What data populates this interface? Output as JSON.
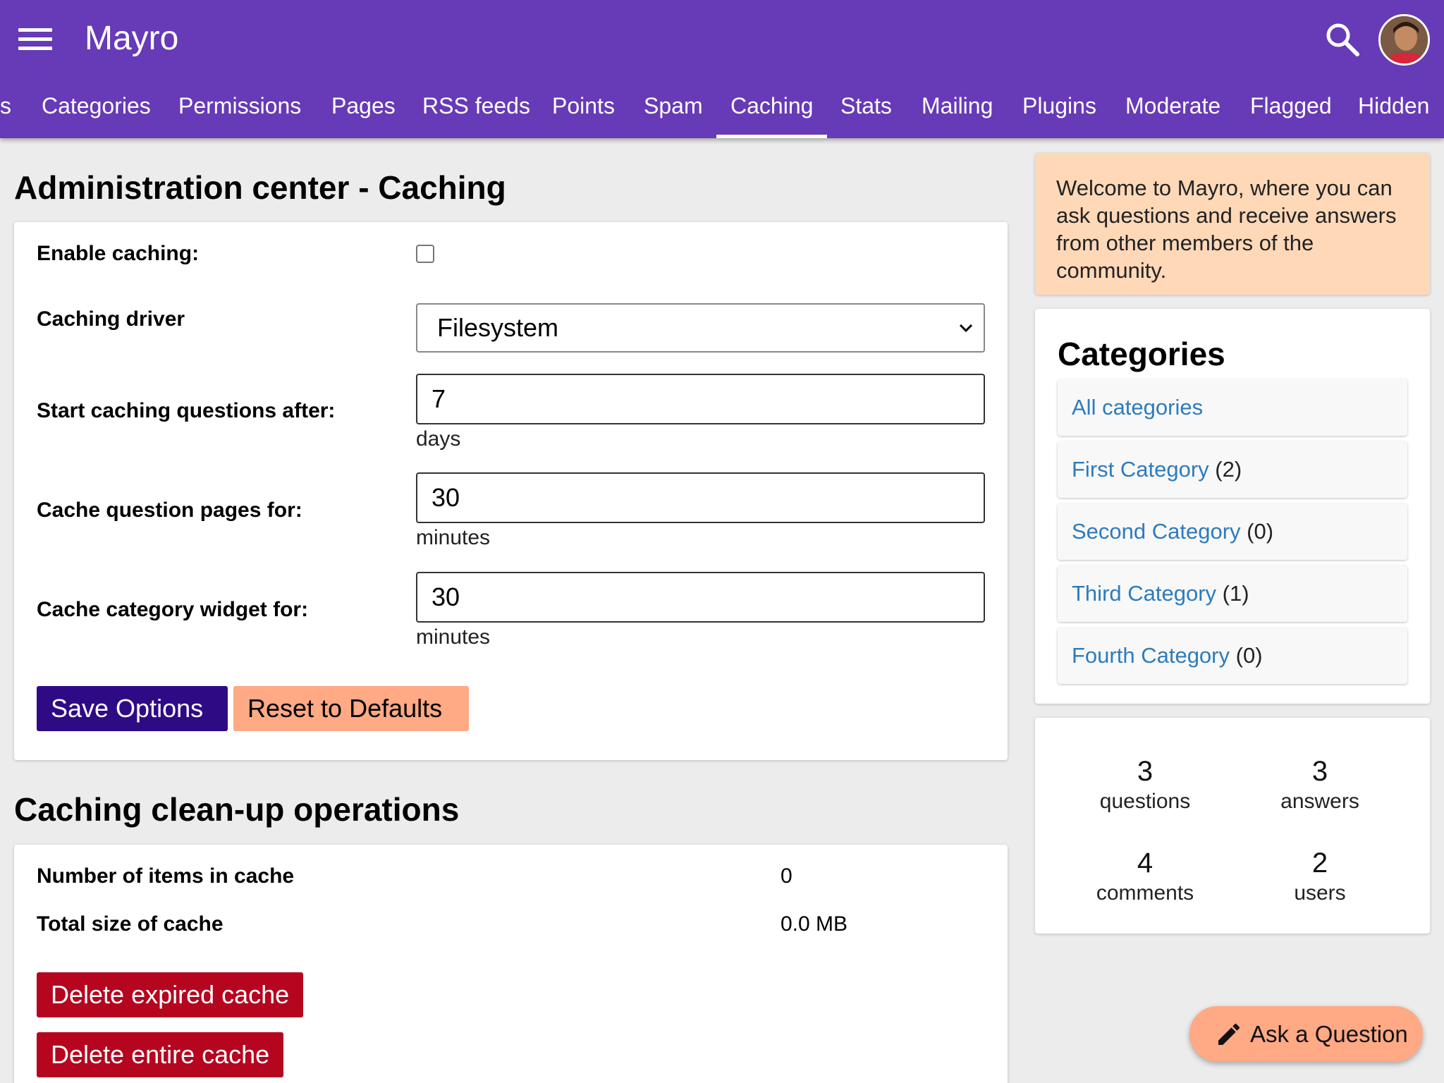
{
  "app": {
    "title": "Mayro"
  },
  "header": {
    "menu_icon": "hamburger-menu-icon",
    "search_icon": "search-icon",
    "avatar_icon": "user-avatar"
  },
  "nav": {
    "tabs": [
      {
        "label": "s"
      },
      {
        "label": "Categories"
      },
      {
        "label": "Permissions"
      },
      {
        "label": "Pages"
      },
      {
        "label": "RSS feeds"
      },
      {
        "label": "Points"
      },
      {
        "label": "Spam"
      },
      {
        "label": "Caching",
        "active": true
      },
      {
        "label": "Stats"
      },
      {
        "label": "Mailing"
      },
      {
        "label": "Plugins"
      },
      {
        "label": "Moderate"
      },
      {
        "label": "Flagged"
      },
      {
        "label": "Hidden"
      }
    ]
  },
  "page": {
    "title": "Administration center - Caching"
  },
  "options": {
    "enable_label": "Enable caching:",
    "enable_checked": false,
    "driver_label": "Caching driver",
    "driver_value": "Filesystem",
    "start_label": "Start caching questions after:",
    "start_value": "7",
    "start_unit": "days",
    "pages_label": "Cache question pages for:",
    "pages_value": "30",
    "pages_unit": "minutes",
    "widget_label": "Cache category widget for:",
    "widget_value": "30",
    "widget_unit": "minutes",
    "save_label": "Save Options",
    "reset_label": "Reset to Defaults"
  },
  "cleanup": {
    "title": "Caching clean-up operations",
    "items_label": "Number of items in cache",
    "items_value": "0",
    "size_label": "Total size of cache",
    "size_value": "0.0 MB",
    "delete_expired_label": "Delete expired cache",
    "delete_all_label": "Delete entire cache"
  },
  "sidebar": {
    "welcome": "Welcome to Mayro, where you can ask questions and receive answers from other members of the community.",
    "categories_title": "Categories",
    "categories": [
      {
        "name": "All categories",
        "count": ""
      },
      {
        "name": "First Category",
        "count": "(2)"
      },
      {
        "name": "Second Category",
        "count": "(0)"
      },
      {
        "name": "Third Category",
        "count": "(1)"
      },
      {
        "name": "Fourth Category",
        "count": "(0)"
      }
    ],
    "stats": [
      {
        "value": "3",
        "label": "questions"
      },
      {
        "value": "3",
        "label": "answers"
      },
      {
        "value": "4",
        "label": "comments"
      },
      {
        "value": "2",
        "label": "users"
      }
    ]
  },
  "fab": {
    "label": "Ask a Question",
    "icon": "pencil-icon"
  },
  "colors": {
    "primary": "#673ab7",
    "save": "#2f0a85",
    "accent": "#ffa985",
    "danger": "#b5051f",
    "link": "#2d7bbd",
    "welcome_bg": "#ffd8b8"
  }
}
